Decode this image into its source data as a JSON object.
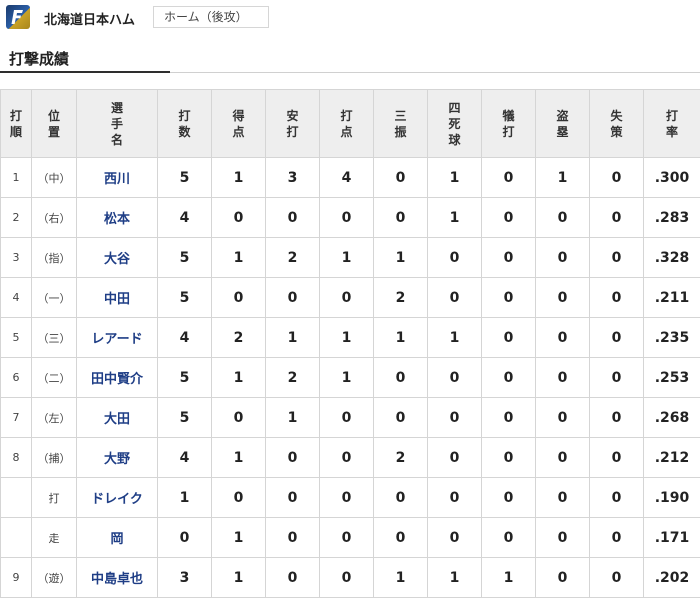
{
  "team": {
    "name": "北海道日本ハム",
    "home_away": "ホーム（後攻）",
    "logo_icon": "fighters-logo-icon"
  },
  "section_title": "打撃成績",
  "columns": [
    "打順",
    "位置",
    "選手名",
    "打数",
    "得点",
    "安打",
    "打点",
    "三振",
    "四死球",
    "犠打",
    "盗塁",
    "失策",
    "打率"
  ],
  "rows": [
    {
      "order": "1",
      "pos": "（中）",
      "name": "西川",
      "ab": "5",
      "r": "1",
      "h": "3",
      "rbi": "4",
      "so": "0",
      "bb": "1",
      "sac": "0",
      "sb": "1",
      "e": "0",
      "avg": ".300"
    },
    {
      "order": "2",
      "pos": "（右）",
      "name": "松本",
      "ab": "4",
      "r": "0",
      "h": "0",
      "rbi": "0",
      "so": "0",
      "bb": "1",
      "sac": "0",
      "sb": "0",
      "e": "0",
      "avg": ".283"
    },
    {
      "order": "3",
      "pos": "（指）",
      "name": "大谷",
      "ab": "5",
      "r": "1",
      "h": "2",
      "rbi": "1",
      "so": "1",
      "bb": "0",
      "sac": "0",
      "sb": "0",
      "e": "0",
      "avg": ".328"
    },
    {
      "order": "4",
      "pos": "（一）",
      "name": "中田",
      "ab": "5",
      "r": "0",
      "h": "0",
      "rbi": "0",
      "so": "2",
      "bb": "0",
      "sac": "0",
      "sb": "0",
      "e": "0",
      "avg": ".211"
    },
    {
      "order": "5",
      "pos": "（三）",
      "name": "レアード",
      "ab": "4",
      "r": "2",
      "h": "1",
      "rbi": "1",
      "so": "1",
      "bb": "1",
      "sac": "0",
      "sb": "0",
      "e": "0",
      "avg": ".235"
    },
    {
      "order": "6",
      "pos": "（二）",
      "name": "田中賢介",
      "ab": "5",
      "r": "1",
      "h": "2",
      "rbi": "1",
      "so": "0",
      "bb": "0",
      "sac": "0",
      "sb": "0",
      "e": "0",
      "avg": ".253"
    },
    {
      "order": "7",
      "pos": "（左）",
      "name": "大田",
      "ab": "5",
      "r": "0",
      "h": "1",
      "rbi": "0",
      "so": "0",
      "bb": "0",
      "sac": "0",
      "sb": "0",
      "e": "0",
      "avg": ".268"
    },
    {
      "order": "8",
      "pos": "（捕）",
      "name": "大野",
      "ab": "4",
      "r": "1",
      "h": "0",
      "rbi": "0",
      "so": "2",
      "bb": "0",
      "sac": "0",
      "sb": "0",
      "e": "0",
      "avg": ".212"
    },
    {
      "order": "",
      "pos": "打",
      "name": "ドレイク",
      "ab": "1",
      "r": "0",
      "h": "0",
      "rbi": "0",
      "so": "0",
      "bb": "0",
      "sac": "0",
      "sb": "0",
      "e": "0",
      "avg": ".190"
    },
    {
      "order": "",
      "pos": "走",
      "name": "岡",
      "ab": "0",
      "r": "1",
      "h": "0",
      "rbi": "0",
      "so": "0",
      "bb": "0",
      "sac": "0",
      "sb": "0",
      "e": "0",
      "avg": ".171"
    },
    {
      "order": "9",
      "pos": "（遊）",
      "name": "中島卓也",
      "ab": "3",
      "r": "1",
      "h": "0",
      "rbi": "0",
      "so": "1",
      "bb": "1",
      "sac": "1",
      "sb": "0",
      "e": "0",
      "avg": ".202"
    }
  ],
  "colors": {
    "player_name": "#1f3e86",
    "header_bg": "#eeeeee",
    "border": "#d5d5d5"
  }
}
